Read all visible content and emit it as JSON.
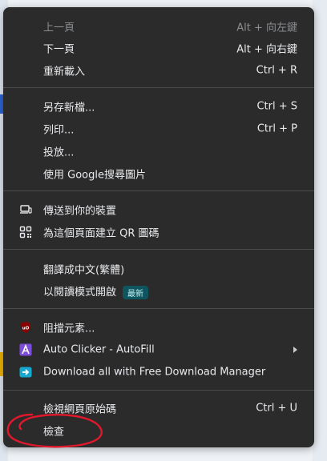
{
  "menu": {
    "items": [
      {
        "label": "上一頁",
        "shortcut": "Alt + 向左鍵"
      },
      {
        "label": "下一頁",
        "shortcut": "Alt + 向右鍵"
      },
      {
        "label": "重新載入",
        "shortcut": "Ctrl + R"
      },
      {
        "label": "另存新檔...",
        "shortcut": "Ctrl + S"
      },
      {
        "label": "列印...",
        "shortcut": "Ctrl + P"
      },
      {
        "label": "投放..."
      },
      {
        "label": "使用 Google搜尋圖片"
      },
      {
        "label": "傳送到你的裝置"
      },
      {
        "label": "為這個頁面建立 QR 圖碼"
      },
      {
        "label": "翻譯成中文(繁體)"
      },
      {
        "label": "以閱讀模式開啟",
        "badge": "最新"
      },
      {
        "label": "阻擋元素..."
      },
      {
        "label": "Auto Clicker - AutoFill"
      },
      {
        "label": "Download all with Free Download Manager"
      },
      {
        "label": "檢視網頁原始碼",
        "shortcut": "Ctrl + U"
      },
      {
        "label": "檢查"
      }
    ]
  },
  "colors": {
    "menu_bg": "#2b2b2b",
    "separator": "#4a4b4e",
    "annotation": "#e0182c"
  },
  "icons": {
    "cast": "devices-icon",
    "qr": "qr-code-icon",
    "ublock": "ublock-origin-icon",
    "autoclicker": "autoclicker-icon",
    "fdm": "free-download-manager-icon"
  }
}
